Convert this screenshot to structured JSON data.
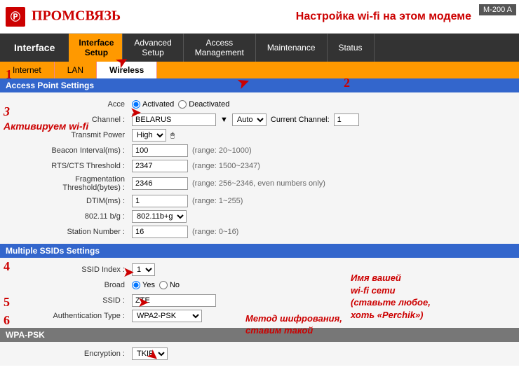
{
  "header": {
    "logo_text": "ПРОМСВЯЗЬ",
    "title": "Настройка wi-fi на этом модеме",
    "model": "M-200 A"
  },
  "nav": {
    "tabs": [
      {
        "label": "Interface\nSetup",
        "active": true
      },
      {
        "label": "Advanced\nSetup",
        "active": false
      },
      {
        "label": "Access\nManagement",
        "active": false
      },
      {
        "label": "Maintenance",
        "active": false
      },
      {
        "label": "Status",
        "active": false
      }
    ],
    "interface_label": "Interface",
    "sub_tabs": [
      {
        "label": "Internet",
        "active": false
      },
      {
        "label": "LAN",
        "active": false
      },
      {
        "label": "Wireless",
        "active": true
      }
    ]
  },
  "access_point": {
    "section_title": "Access Point Settings",
    "fields": [
      {
        "label": "Acce",
        "type": "radio",
        "options": [
          "Activated",
          "Deactivated"
        ],
        "selected": "Activated"
      },
      {
        "label": "Channel :",
        "type": "select_text",
        "value": "BELARUS",
        "extra": "Auto",
        "extra2": "Current Channel:",
        "extra3": "1"
      },
      {
        "label": "Transmit Power",
        "type": "select",
        "value": "High"
      },
      {
        "label": "Beacon Interval(ms) :",
        "type": "text",
        "value": "100",
        "range": "(range: 20~1000)"
      },
      {
        "label": "RTS/CTS Threshold :",
        "type": "text",
        "value": "2347",
        "range": "(range: 1500~2347)"
      },
      {
        "label": "Fragmentation\nThreshold(bytes) :",
        "type": "text",
        "value": "2346",
        "range": "(range: 256~2346, even numbers only)"
      },
      {
        "label": "DTIM(ms) :",
        "type": "text",
        "value": "1",
        "range": "(range: 1~255)"
      },
      {
        "label": "802.11 b/g :",
        "type": "select",
        "value": "802.11b+g"
      },
      {
        "label": "Station Number :",
        "type": "text",
        "value": "16",
        "range": "(range: 0~16)"
      }
    ]
  },
  "multiple_ssids": {
    "section_title": "Multiple SSIDs Settings",
    "fields": [
      {
        "label": "SSID Index :",
        "type": "select",
        "value": "1"
      },
      {
        "label": "Broad",
        "type": "radio",
        "options": [
          "Yes",
          "No"
        ],
        "selected": "Yes"
      },
      {
        "label": "SSID :",
        "type": "text",
        "value": "ZTE"
      },
      {
        "label": "Authentication Type :",
        "type": "select",
        "value": "WPA2-PSK"
      }
    ]
  },
  "wpa_psk": {
    "section_title": "WPA-PSK",
    "fields": [
      {
        "label": "Encryption :",
        "type": "select",
        "value": "TKIP"
      }
    ]
  },
  "annotations": {
    "ann1": "1",
    "ann2": "2",
    "ann3": "3",
    "ann3_text": "Активируем wi-fi",
    "ann4": "4",
    "ann5": "5",
    "ann5_text": "Имя вашей\nwi-fi сети\n(ставьте любое,\nхоть «Perchik»)",
    "ann6": "6",
    "ann6_text": "Метод шифрования,\nставим такой"
  }
}
